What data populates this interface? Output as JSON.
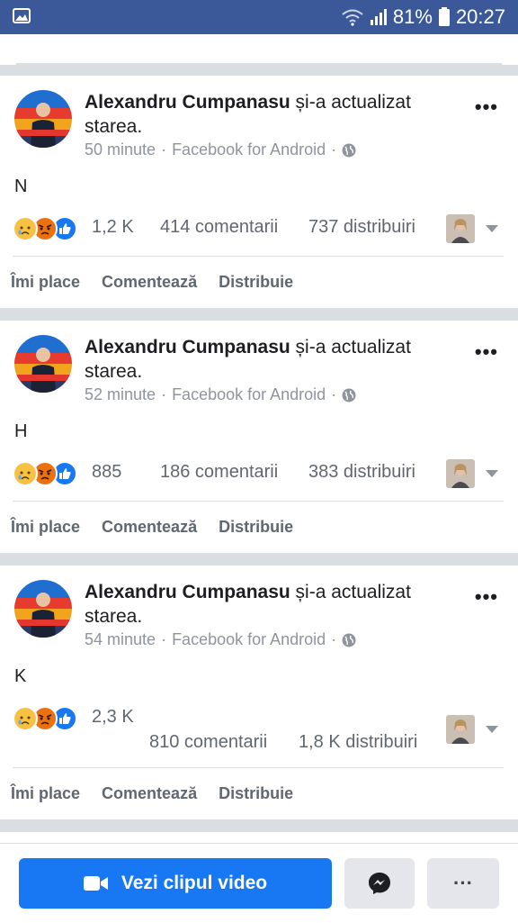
{
  "status_bar": {
    "battery": "81%",
    "time": "20:27",
    "icons": [
      "gallery-icon",
      "wifi-icon",
      "signal-icon",
      "battery-icon"
    ]
  },
  "posts": [
    {
      "author": "Alexandru Cumpanasu",
      "action_text": " și-a actualizat starea.",
      "time": "50 minute",
      "source": "Facebook for Android",
      "text": "N",
      "reactions_count": "1,2 K",
      "comments": "414 comentarii",
      "shares": "737 distribuiri",
      "actions": [
        "Îmi place",
        "Comentează",
        "Distribuie"
      ]
    },
    {
      "author": "Alexandru Cumpanasu",
      "action_text": " și-a actualizat starea.",
      "time": "52 minute",
      "source": "Facebook for Android",
      "text": "H",
      "reactions_count": "885",
      "comments": "186 comentarii",
      "shares": "383 distribuiri",
      "actions": [
        "Îmi place",
        "Comentează",
        "Distribuie"
      ]
    },
    {
      "author": "Alexandru Cumpanasu",
      "action_text": " și-a actualizat starea.",
      "time": "54 minute",
      "source": "Facebook for Android",
      "text": "K",
      "reactions_count": "2,3 K",
      "comments": "810 comentarii",
      "shares": "1,8 K distribuiri",
      "actions": [
        "Îmi place",
        "Comentează",
        "Distribuie"
      ]
    }
  ],
  "bottom_bar": {
    "video_button": "Vezi clipul video",
    "more_label": "···"
  },
  "colors": {
    "status_bar": "#3b5998",
    "primary_button": "#1877f2",
    "divider": "#dadde1",
    "muted_text": "#606770"
  }
}
